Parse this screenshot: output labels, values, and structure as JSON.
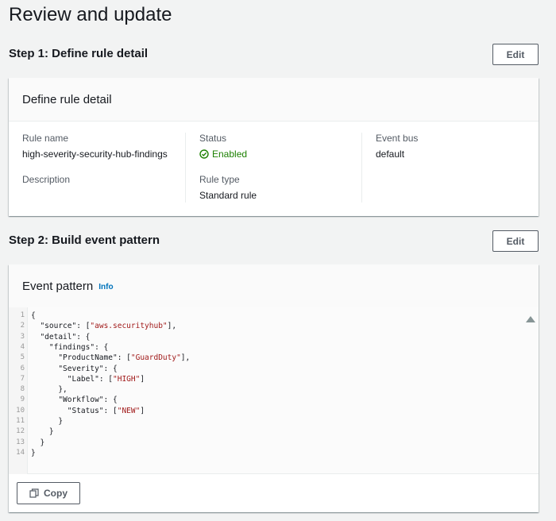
{
  "page": {
    "title": "Review and update"
  },
  "step1": {
    "title": "Step 1: Define rule detail",
    "edit_label": "Edit",
    "card_title": "Define rule detail",
    "rule_name_label": "Rule name",
    "rule_name_value": "high-severity-security-hub-findings",
    "description_label": "Description",
    "status_label": "Status",
    "status_value": "Enabled",
    "rule_type_label": "Rule type",
    "rule_type_value": "Standard rule",
    "event_bus_label": "Event bus",
    "event_bus_value": "default"
  },
  "step2": {
    "title": "Step 2: Build event pattern",
    "edit_label": "Edit",
    "card_title": "Event pattern",
    "info_label": "Info",
    "copy_label": "Copy",
    "code_lines": [
      "{",
      "  \"source\": [\"aws.securityhub\"],",
      "  \"detail\": {",
      "    \"findings\": {",
      "      \"ProductName\": [\"GuardDuty\"],",
      "      \"Severity\": {",
      "        \"Label\": [\"HIGH\"]",
      "      },",
      "      \"Workflow\": {",
      "        \"Status\": [\"NEW\"]",
      "      }",
      "    }",
      "  }",
      "}"
    ]
  },
  "colors": {
    "success": "#1d8102",
    "link": "#0073bb",
    "string": "#a11b1b"
  }
}
